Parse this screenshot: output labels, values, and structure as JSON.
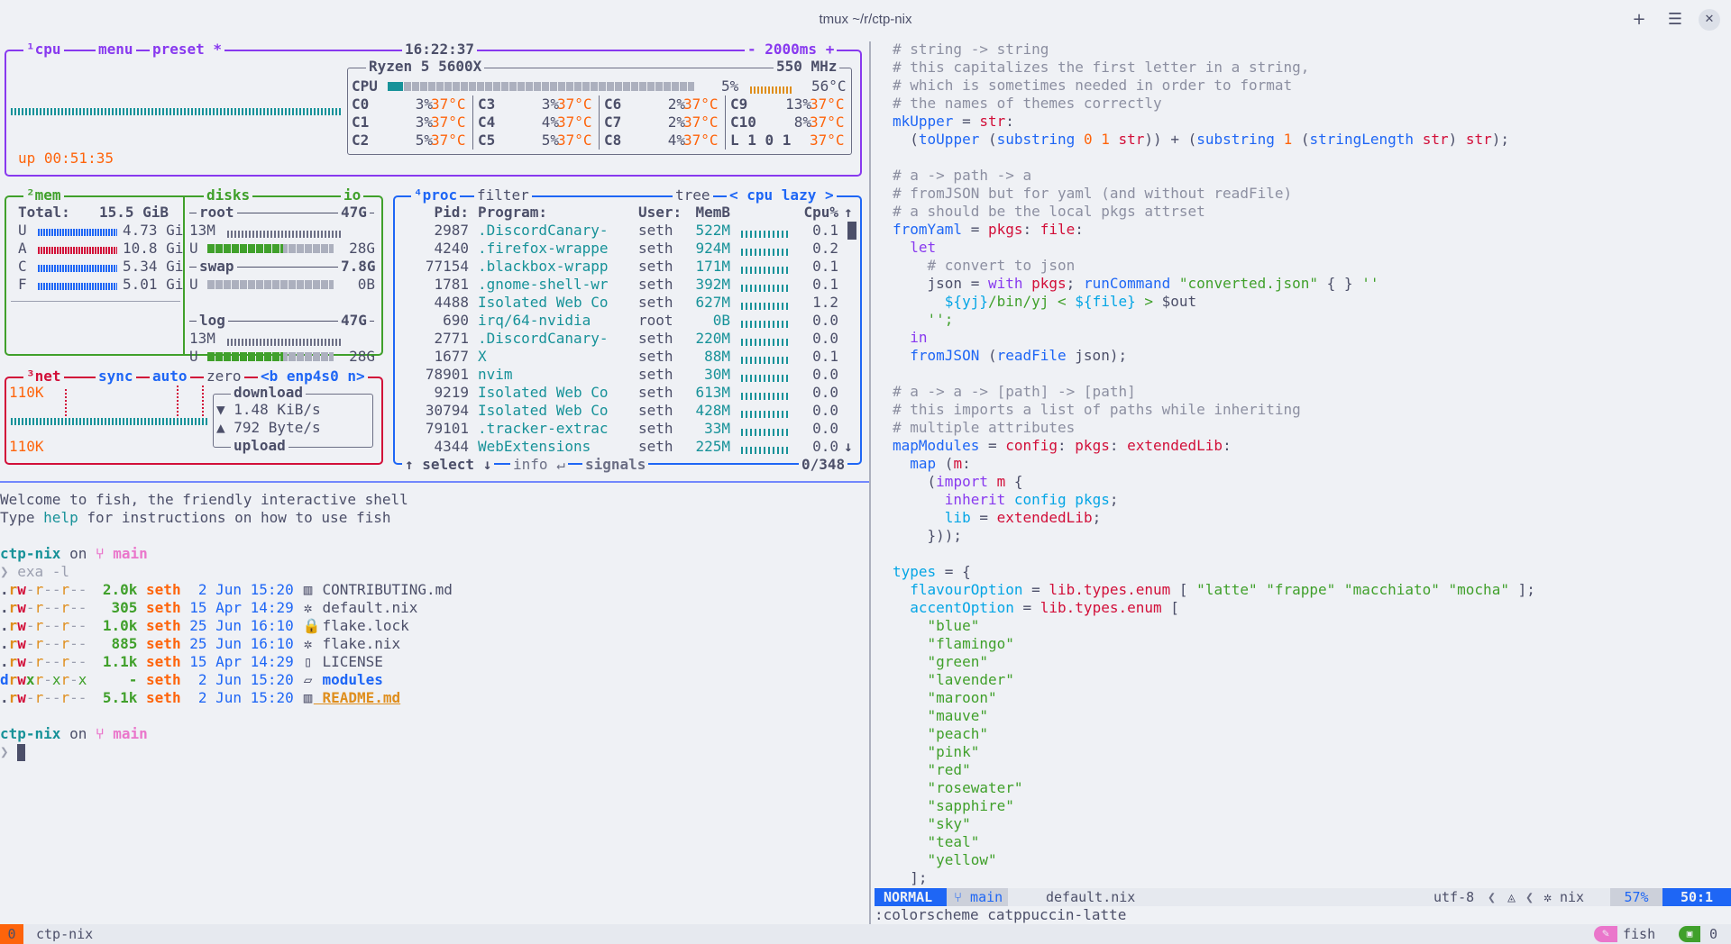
{
  "window": {
    "title": "tmux ~/r/ctp-nix",
    "add_icon": "+",
    "menu_icon": "☰",
    "close_icon": "✕"
  },
  "btop": {
    "cpu_box": {
      "tabs": [
        "¹cpu",
        "menu",
        "preset *"
      ],
      "clock": "16:22:37",
      "interval": "- 2000ms +",
      "model": "Ryzen 5 5600X",
      "freq": "550 MHz",
      "uptime": "up 00:51:35",
      "total": {
        "label": "CPU",
        "pct": "5%",
        "temp": "56°C",
        "fill": 0.05
      },
      "cores": [
        {
          "name": "C0",
          "pct": "3%",
          "temp": "37°C"
        },
        {
          "name": "C1",
          "pct": "3%",
          "temp": "37°C"
        },
        {
          "name": "C2",
          "pct": "5%",
          "temp": "37°C"
        },
        {
          "name": "C3",
          "pct": "3%",
          "temp": "37°C"
        },
        {
          "name": "C4",
          "pct": "4%",
          "temp": "37°C"
        },
        {
          "name": "C5",
          "pct": "5%",
          "temp": "37°C"
        },
        {
          "name": "C6",
          "pct": "2%",
          "temp": "37°C"
        },
        {
          "name": "C7",
          "pct": "2%",
          "temp": "37°C"
        },
        {
          "name": "C8",
          "pct": "4%",
          "temp": "37°C"
        },
        {
          "name": "C9",
          "pct": "13%",
          "temp": "37°C"
        },
        {
          "name": "C10",
          "pct": "8%",
          "temp": "37°C"
        },
        {
          "name": "L 1 0 1",
          "pct": "",
          "temp": "37°C"
        }
      ]
    },
    "mem_box": {
      "title": "²mem",
      "total_label": "Total:",
      "total": "15.5 GiB",
      "rows": [
        {
          "k": "U",
          "v": "4.73 Gi",
          "color": "#1e66f5"
        },
        {
          "k": "A",
          "v": "10.8 Gi",
          "color": "#d20f39"
        },
        {
          "k": "C",
          "v": "5.34 Gi",
          "color": "#1e66f5"
        },
        {
          "k": "F",
          "v": "5.01 Gi",
          "color": "#1e66f5"
        }
      ]
    },
    "disks_box": {
      "title": "disks",
      "io": "io",
      "disks": [
        {
          "name": "root",
          "size": "47G",
          "used_label": "13M",
          "u": "U",
          "u_val": "28G",
          "fill": 0.6
        },
        {
          "name": "swap",
          "size": "7.8G",
          "used_label": "",
          "u": "U",
          "u_val": "0B",
          "fill": 0.0
        },
        {
          "name": "log",
          "size": "47G",
          "used_label": "13M",
          "u": "U",
          "u_val": "28G",
          "fill": 0.6
        }
      ]
    },
    "net_box": {
      "title": "³net",
      "tabs": [
        "sync",
        "auto",
        "zero",
        "<b enp4s0 n>"
      ],
      "top_scale": "110K",
      "bottom_scale": "110K",
      "download_label": "download",
      "download_val": "▼ 1.48 KiB/s",
      "upload_val": "▲ 792 Byte/s",
      "upload_label": "upload"
    },
    "proc_box": {
      "title": "⁴proc",
      "filter": "filter",
      "tree": "tree",
      "sort": "< cpu lazy >",
      "headers": [
        "Pid:",
        "Program:",
        "User:",
        "MemB",
        "Cpu%"
      ],
      "rows": [
        {
          "pid": "2987",
          "prog": ".DiscordCanary-",
          "user": "seth",
          "mem": "522M",
          "cpu": "0.1"
        },
        {
          "pid": "4240",
          "prog": ".firefox-wrappe",
          "user": "seth",
          "mem": "924M",
          "cpu": "0.2"
        },
        {
          "pid": "77154",
          "prog": ".blackbox-wrapp",
          "user": "seth",
          "mem": "171M",
          "cpu": "0.1"
        },
        {
          "pid": "1781",
          "prog": ".gnome-shell-wr",
          "user": "seth",
          "mem": "392M",
          "cpu": "0.1"
        },
        {
          "pid": "4488",
          "prog": "Isolated Web Co",
          "user": "seth",
          "mem": "627M",
          "cpu": "1.2"
        },
        {
          "pid": "690",
          "prog": "irq/64-nvidia",
          "user": "root",
          "mem": "0B",
          "cpu": "0.0"
        },
        {
          "pid": "2771",
          "prog": ".DiscordCanary-",
          "user": "seth",
          "mem": "220M",
          "cpu": "0.0"
        },
        {
          "pid": "1677",
          "prog": "X",
          "user": "seth",
          "mem": "88M",
          "cpu": "0.1"
        },
        {
          "pid": "78901",
          "prog": "nvim",
          "user": "seth",
          "mem": "30M",
          "cpu": "0.0"
        },
        {
          "pid": "9219",
          "prog": "Isolated Web Co",
          "user": "seth",
          "mem": "613M",
          "cpu": "0.0"
        },
        {
          "pid": "30794",
          "prog": "Isolated Web Co",
          "user": "seth",
          "mem": "428M",
          "cpu": "0.0"
        },
        {
          "pid": "79101",
          "prog": ".tracker-extrac",
          "user": "seth",
          "mem": "33M",
          "cpu": "0.0"
        },
        {
          "pid": "4344",
          "prog": "WebExtensions",
          "user": "seth",
          "mem": "225M",
          "cpu": "0.0"
        }
      ],
      "footer_select": "↑ select ↓",
      "footer_info": "info ↵",
      "footer_signals": "signals",
      "count": "0/348"
    }
  },
  "fish": {
    "welcome1": "Welcome to fish, the friendly interactive shell",
    "welcome2_a": "Type ",
    "welcome2_help": "help",
    "welcome2_b": " for instructions on how to use fish",
    "prompt_dir": "ctp-nix",
    "prompt_on": " on ",
    "prompt_branch": " main",
    "command": "exa -l",
    "listing": [
      {
        "perm": ".rw-r--r--",
        "size": "2.0k",
        "user": "seth",
        "date": " 2 Jun 15:20",
        "icon": "▥",
        "name": "CONTRIBUTING.md",
        "kind": "md"
      },
      {
        "perm": ".rw-r--r--",
        "size": "305",
        "user": "seth",
        "date": "15 Apr 14:29",
        "icon": "✲",
        "name": "default.nix",
        "kind": "nix"
      },
      {
        "perm": ".rw-r--r--",
        "size": "1.0k",
        "user": "seth",
        "date": "25 Jun 16:10",
        "icon": "🔒",
        "name": "flake.lock",
        "kind": "lock"
      },
      {
        "perm": ".rw-r--r--",
        "size": "885",
        "user": "seth",
        "date": "25 Jun 16:10",
        "icon": "✲",
        "name": "flake.nix",
        "kind": "nix"
      },
      {
        "perm": ".rw-r--r--",
        "size": "1.1k",
        "user": "seth",
        "date": "15 Apr 14:29",
        "icon": "▯",
        "name": "LICENSE",
        "kind": "file"
      },
      {
        "perm": "drwxr-xr-x",
        "size": "-",
        "user": "seth",
        "date": " 2 Jun 15:20",
        "icon": "▱",
        "name": "modules",
        "kind": "dir"
      },
      {
        "perm": ".rw-r--r--",
        "size": "5.1k",
        "user": "seth",
        "date": " 2 Jun 15:20",
        "icon": "▥",
        "name": "README.md",
        "kind": "readme"
      }
    ]
  },
  "nvim": {
    "code": [
      [
        [
          "cmt",
          "# string -> string"
        ]
      ],
      [
        [
          "cmt",
          "# this capitalizes the first letter in a string,"
        ]
      ],
      [
        [
          "cmt",
          "# which is sometimes needed in order to format"
        ]
      ],
      [
        [
          "cmt",
          "# the names of themes correctly"
        ]
      ],
      [
        [
          "fn",
          "mkUpper"
        ],
        [
          "txt",
          " = "
        ],
        [
          "var",
          "str"
        ],
        [
          "txt",
          ":"
        ]
      ],
      [
        [
          "txt",
          "  ("
        ],
        [
          "fn",
          "toUpper"
        ],
        [
          "txt",
          " ("
        ],
        [
          "fn",
          "substring"
        ],
        [
          "txt",
          " "
        ],
        [
          "num",
          "0"
        ],
        [
          "txt",
          " "
        ],
        [
          "num",
          "1"
        ],
        [
          "txt",
          " "
        ],
        [
          "var",
          "str"
        ],
        [
          "txt",
          ")) + ("
        ],
        [
          "fn",
          "substring"
        ],
        [
          "txt",
          " "
        ],
        [
          "num",
          "1"
        ],
        [
          "txt",
          " ("
        ],
        [
          "fn",
          "stringLength"
        ],
        [
          "txt",
          " "
        ],
        [
          "var",
          "str"
        ],
        [
          "txt",
          ") "
        ],
        [
          "var",
          "str"
        ],
        [
          "txt",
          ");"
        ]
      ],
      [
        [
          "txt",
          ""
        ]
      ],
      [
        [
          "cmt",
          "# a -> path -> a"
        ]
      ],
      [
        [
          "cmt",
          "# fromJSON but for yaml (and without readFile)"
        ]
      ],
      [
        [
          "cmt",
          "# a should be the local pkgs attrset"
        ]
      ],
      [
        [
          "fn",
          "fromYaml"
        ],
        [
          "txt",
          " = "
        ],
        [
          "var",
          "pkgs"
        ],
        [
          "txt",
          ": "
        ],
        [
          "var",
          "file"
        ],
        [
          "txt",
          ":"
        ]
      ],
      [
        [
          "kw",
          "  let"
        ]
      ],
      [
        [
          "cmt",
          "    # convert to json"
        ]
      ],
      [
        [
          "txt",
          "    json = "
        ],
        [
          "kw",
          "with"
        ],
        [
          "txt",
          " "
        ],
        [
          "var",
          "pkgs"
        ],
        [
          "txt",
          "; "
        ],
        [
          "fn",
          "runCommand"
        ],
        [
          "txt",
          " "
        ],
        [
          "str",
          "\"converted.json\""
        ],
        [
          "txt",
          " { } "
        ],
        [
          "str",
          "''"
        ]
      ],
      [
        [
          "txt",
          "      "
        ],
        [
          "op",
          "${yj}"
        ],
        [
          "str",
          "/bin/yj < "
        ],
        [
          "op",
          "${file}"
        ],
        [
          "str",
          " > "
        ],
        [
          "txt",
          "$out"
        ]
      ],
      [
        [
          "str",
          "    '';"
        ]
      ],
      [
        [
          "kw",
          "  in"
        ]
      ],
      [
        [
          "txt",
          "  "
        ],
        [
          "fn",
          "fromJSON"
        ],
        [
          "txt",
          " ("
        ],
        [
          "fn",
          "readFile"
        ],
        [
          "txt",
          " json);"
        ]
      ],
      [
        [
          "txt",
          ""
        ]
      ],
      [
        [
          "cmt",
          "# a -> a -> [path] -> [path]"
        ]
      ],
      [
        [
          "cmt",
          "# this imports a list of paths while inheriting"
        ]
      ],
      [
        [
          "cmt",
          "# multiple attributes"
        ]
      ],
      [
        [
          "fn",
          "mapModules"
        ],
        [
          "txt",
          " = "
        ],
        [
          "var",
          "config"
        ],
        [
          "txt",
          ": "
        ],
        [
          "var",
          "pkgs"
        ],
        [
          "txt",
          ": "
        ],
        [
          "var",
          "extendedLib"
        ],
        [
          "txt",
          ":"
        ]
      ],
      [
        [
          "txt",
          "  "
        ],
        [
          "fn",
          "map"
        ],
        [
          "txt",
          " ("
        ],
        [
          "var",
          "m"
        ],
        [
          "txt",
          ":"
        ]
      ],
      [
        [
          "txt",
          "    ("
        ],
        [
          "kw",
          "import"
        ],
        [
          "txt",
          " "
        ],
        [
          "var",
          "m"
        ],
        [
          "txt",
          " {"
        ]
      ],
      [
        [
          "txt",
          "      "
        ],
        [
          "kw",
          "inherit"
        ],
        [
          "txt",
          " "
        ],
        [
          "op",
          "config pkgs"
        ],
        [
          "txt",
          ";"
        ]
      ],
      [
        [
          "txt",
          "      "
        ],
        [
          "op",
          "lib"
        ],
        [
          "txt",
          " = "
        ],
        [
          "var",
          "extendedLib"
        ],
        [
          "txt",
          ";"
        ]
      ],
      [
        [
          "txt",
          "    }));"
        ]
      ],
      [
        [
          "txt",
          ""
        ]
      ],
      [
        [
          "op",
          "types"
        ],
        [
          "txt",
          " = {"
        ]
      ],
      [
        [
          "txt",
          "  "
        ],
        [
          "op",
          "flavourOption"
        ],
        [
          "txt",
          " = "
        ],
        [
          "var",
          "lib.types.enum"
        ],
        [
          "txt",
          " [ "
        ],
        [
          "str",
          "\"latte\" \"frappe\" \"macchiato\" \"mocha\""
        ],
        [
          "txt",
          " ];"
        ]
      ],
      [
        [
          "txt",
          "  "
        ],
        [
          "op",
          "accentOption"
        ],
        [
          "txt",
          " = "
        ],
        [
          "var",
          "lib.types.enum"
        ],
        [
          "txt",
          " ["
        ]
      ],
      [
        [
          "str",
          "    \"blue\""
        ]
      ],
      [
        [
          "str",
          "    \"flamingo\""
        ]
      ],
      [
        [
          "str",
          "    \"green\""
        ]
      ],
      [
        [
          "str",
          "    \"lavender\""
        ]
      ],
      [
        [
          "str",
          "    \"maroon\""
        ]
      ],
      [
        [
          "str",
          "    \"mauve\""
        ]
      ],
      [
        [
          "str",
          "    \"peach\""
        ]
      ],
      [
        [
          "str",
          "    \"pink\""
        ]
      ],
      [
        [
          "str",
          "    \"red\""
        ]
      ],
      [
        [
          "str",
          "    \"rosewater\""
        ]
      ],
      [
        [
          "str",
          "    \"sapphire\""
        ]
      ],
      [
        [
          "str",
          "    \"sky\""
        ]
      ],
      [
        [
          "str",
          "    \"teal\""
        ]
      ],
      [
        [
          "str",
          "    \"yellow\""
        ]
      ],
      [
        [
          "txt",
          "  ];"
        ]
      ]
    ],
    "status": {
      "mode": "NORMAL",
      "branch": " main",
      "file": "default.nix",
      "encoding": "utf-8",
      "os_icon": "◬",
      "ft_icon": "✲",
      "filetype": "nix",
      "percent": "57%",
      "position": "50:1"
    },
    "cmdline": ":colorscheme catppuccin-latte"
  },
  "tmux": {
    "index": "0",
    "session": "ctp-nix",
    "right_icon": "✎",
    "shell": "fish",
    "win_index": "0"
  },
  "colors": {
    "base": "#eff1f5",
    "text": "#4c4f69",
    "mauve": "#8839ef",
    "green": "#40a02b",
    "blue": "#1e66f5",
    "red": "#d20f39",
    "peach": "#fe640b",
    "teal": "#179299",
    "pink": "#ea76cb"
  }
}
